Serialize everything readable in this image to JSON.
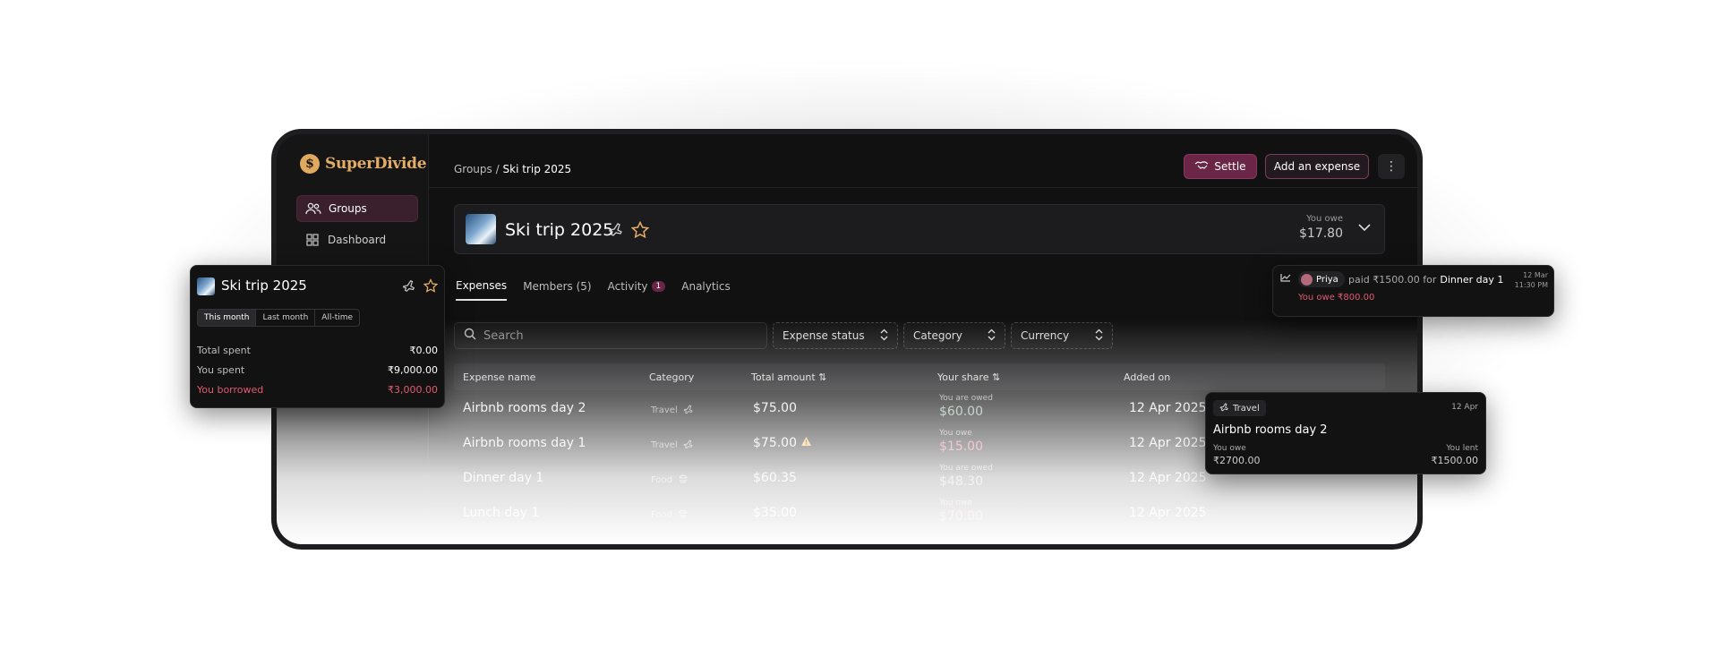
{
  "brand": {
    "name": "SuperDivide",
    "logo_glyph": "$",
    "accent": "#e3ad66",
    "primary": "#6b2546"
  },
  "sidebar": {
    "items": [
      {
        "label": "Groups",
        "icon": "users-icon",
        "active": true
      },
      {
        "label": "Dashboard",
        "icon": "grid-icon",
        "active": false
      }
    ]
  },
  "header": {
    "breadcrumb_parent": "Groups",
    "breadcrumb_sep": "/",
    "breadcrumb_current": "Ski trip 2025",
    "settle_label": "Settle",
    "add_expense_label": "Add an expense",
    "more_glyph": "⋮"
  },
  "group": {
    "title": "Ski trip 2025",
    "you_owe_label": "You owe",
    "you_owe_amount": "$17.80"
  },
  "tabs": [
    {
      "label": "Expenses",
      "active": true
    },
    {
      "label": "Members (5)",
      "active": false
    },
    {
      "label": "Activity",
      "badge": "1",
      "active": false
    },
    {
      "label": "Analytics",
      "active": false
    }
  ],
  "filters": {
    "search_placeholder": "Search",
    "status_label": "Expense status",
    "category_label": "Category",
    "currency_label": "Currency"
  },
  "table": {
    "columns": [
      "Expense name",
      "Category",
      "Total amount",
      "Your share",
      "Added on"
    ],
    "rows": [
      {
        "name": "Airbnb rooms day 2",
        "category": "Travel",
        "amount": "$75.00",
        "warn": false,
        "share_label": "You are owed",
        "share": "$60.00",
        "kind": "owed",
        "date": "12 Apr 2025"
      },
      {
        "name": "Airbnb rooms day 1",
        "category": "Travel",
        "amount": "$75.00",
        "warn": true,
        "share_label": "You owe",
        "share": "$15.00",
        "kind": "owe",
        "date": "12 Apr 2025"
      },
      {
        "name": "Dinner day 1",
        "category": "Food",
        "amount": "$60.35",
        "warn": false,
        "share_label": "You are owed",
        "share": "$48.30",
        "kind": "owed",
        "date": "12 Apr 2025"
      },
      {
        "name": "Lunch day 1",
        "category": "Food",
        "amount": "$35.00",
        "warn": false,
        "share_label": "You owe",
        "share": "$70.00",
        "kind": "owe",
        "date": "12 Apr 2025"
      }
    ]
  },
  "summary_panel": {
    "title": "Ski trip 2025",
    "periods": [
      "This month",
      "Last month",
      "All-time"
    ],
    "rows": [
      {
        "label": "Total spent",
        "value": "₹0.00"
      },
      {
        "label": "You spent",
        "value": "₹9,000.00"
      },
      {
        "label": "You borrowed",
        "value": "₹3,000.00"
      }
    ]
  },
  "activity_panel": {
    "name": "Priya",
    "verb": "paid ₹1500.00 for",
    "item": "Dinner day 1",
    "date": "12 Mar",
    "time": "11:30 PM",
    "sub": "You owe ₹800.00"
  },
  "expense_panel": {
    "tag": "Travel",
    "date": "12 Apr",
    "title": "Airbnb rooms day 2",
    "left_label": "You owe",
    "left_value": "₹2700.00",
    "right_label": "You lent",
    "right_value": "₹1500.00"
  }
}
